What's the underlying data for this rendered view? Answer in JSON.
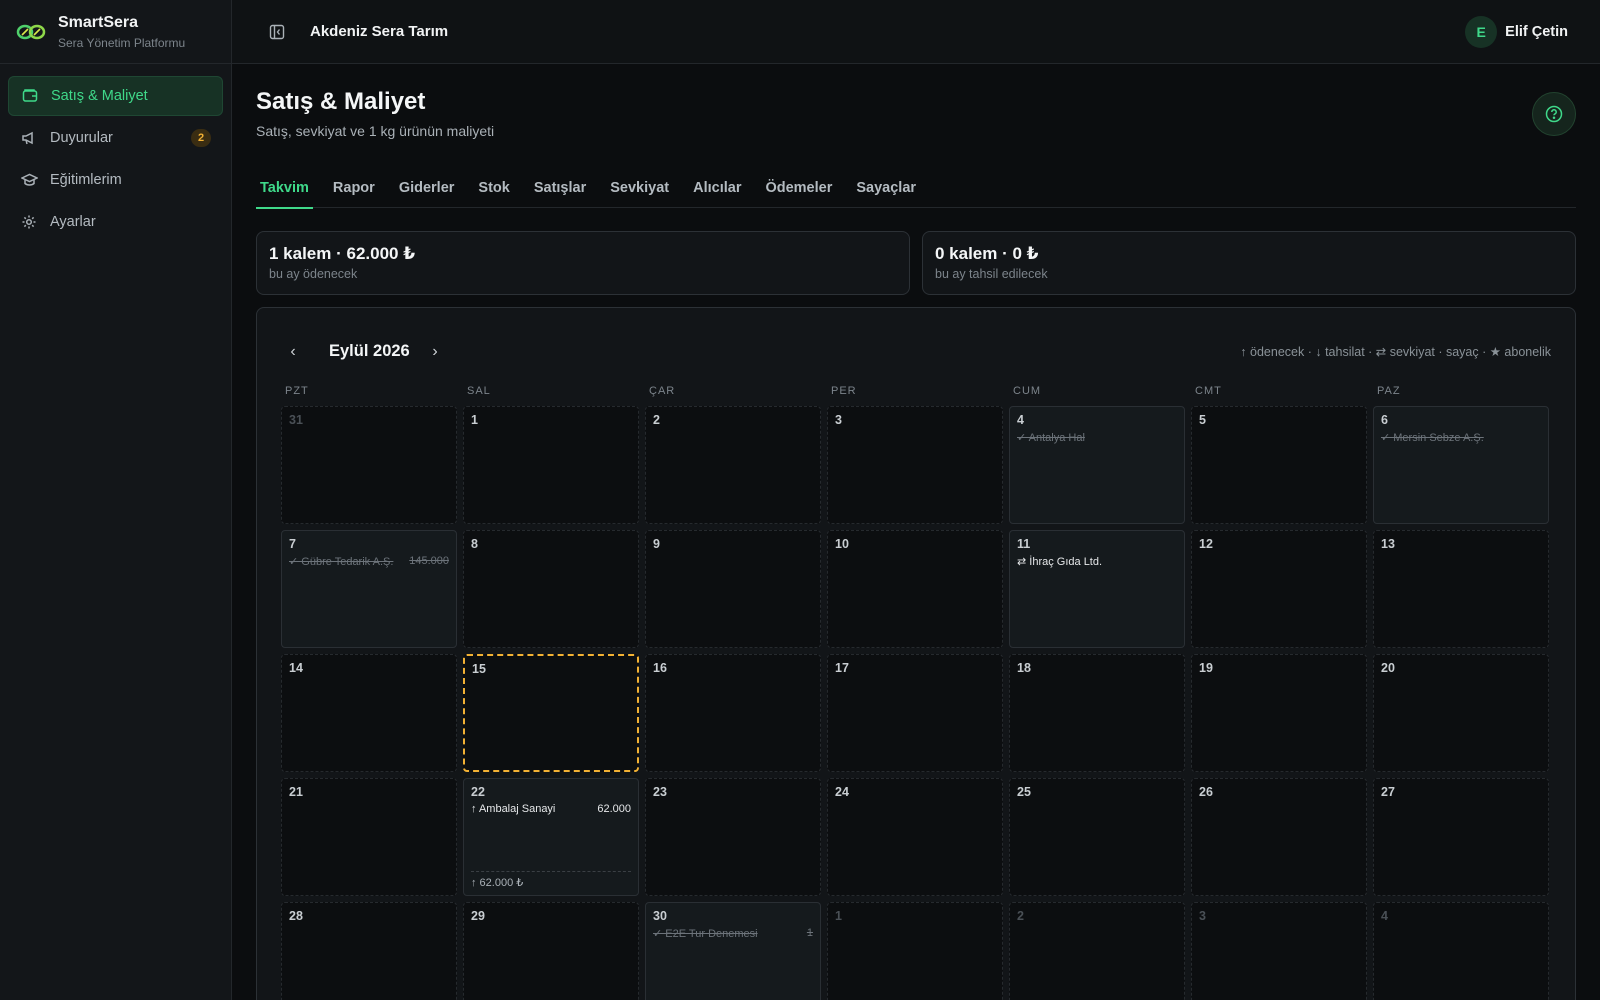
{
  "app": {
    "name": "SmartSera",
    "subtitle": "Sera Yönetim Platformu"
  },
  "sidebar": {
    "items": [
      {
        "label": "Satış & Maliyet",
        "icon": "wallet-icon",
        "active": true
      },
      {
        "label": "Duyurular",
        "icon": "megaphone-icon",
        "badge": "2"
      },
      {
        "label": "Eğitimlerim",
        "icon": "graduation-cap-icon"
      },
      {
        "label": "Ayarlar",
        "icon": "gear-icon"
      }
    ]
  },
  "topbar": {
    "organization": "Akdeniz Sera Tarım",
    "user": {
      "initial": "E",
      "name": "Elif Çetin"
    }
  },
  "page": {
    "title": "Satış & Maliyet",
    "subtitle": "Satış, sevkiyat ve 1 kg ürünün maliyeti"
  },
  "tabs": [
    {
      "label": "Takvim",
      "active": true
    },
    {
      "label": "Rapor"
    },
    {
      "label": "Giderler"
    },
    {
      "label": "Stok"
    },
    {
      "label": "Satışlar"
    },
    {
      "label": "Sevkiyat"
    },
    {
      "label": "Alıcılar"
    },
    {
      "label": "Ödemeler"
    },
    {
      "label": "Sayaçlar"
    }
  ],
  "summary": [
    {
      "value": "1 kalem · 62.000 ₺",
      "label": "bu ay ödenecek"
    },
    {
      "value": "0 kalem · 0 ₺",
      "label": "bu ay tahsil edilecek"
    }
  ],
  "calendar": {
    "prev": "‹",
    "next": "›",
    "month": "Eylül 2026",
    "legend": "↑ ödenecek · ↓ tahsilat · ⇄ sevkiyat · sayaç · ★ abonelik",
    "weekdays": [
      "PZT",
      "SAL",
      "ÇAR",
      "PER",
      "CUM",
      "CMT",
      "PAZ"
    ],
    "days": [
      {
        "n": "31",
        "out": true
      },
      {
        "n": "1"
      },
      {
        "n": "2"
      },
      {
        "n": "3"
      },
      {
        "n": "4",
        "events": [
          {
            "icon": "✓",
            "name": "Antalya Hal",
            "amount": "",
            "done": true
          }
        ]
      },
      {
        "n": "5"
      },
      {
        "n": "6",
        "events": [
          {
            "icon": "✓",
            "name": "Mersin Sebze A.Ş.",
            "amount": "",
            "done": true
          }
        ]
      },
      {
        "n": "7",
        "events": [
          {
            "icon": "✓",
            "name": "Gübre Tedarik A.Ş.",
            "amount": "145.000",
            "done": true
          }
        ]
      },
      {
        "n": "8"
      },
      {
        "n": "9"
      },
      {
        "n": "10"
      },
      {
        "n": "11",
        "events": [
          {
            "icon": "⇄",
            "name": "İhraç Gıda Ltd.",
            "amount": "",
            "done": false
          }
        ]
      },
      {
        "n": "12"
      },
      {
        "n": "13"
      },
      {
        "n": "14"
      },
      {
        "n": "15",
        "today": true
      },
      {
        "n": "16"
      },
      {
        "n": "17"
      },
      {
        "n": "18"
      },
      {
        "n": "19"
      },
      {
        "n": "20"
      },
      {
        "n": "21"
      },
      {
        "n": "22",
        "events": [
          {
            "icon": "↑",
            "name": "Ambalaj Sanayi",
            "amount": "62.000",
            "done": false
          }
        ],
        "total": "↑ 62.000 ₺"
      },
      {
        "n": "23"
      },
      {
        "n": "24"
      },
      {
        "n": "25"
      },
      {
        "n": "26"
      },
      {
        "n": "27"
      },
      {
        "n": "28"
      },
      {
        "n": "29"
      },
      {
        "n": "30",
        "events": [
          {
            "icon": "✓",
            "name": "E2E Tur Denemesi",
            "amount": "1",
            "done": true
          }
        ]
      },
      {
        "n": "1",
        "out": true
      },
      {
        "n": "2",
        "out": true
      },
      {
        "n": "3",
        "out": true
      },
      {
        "n": "4",
        "out": true
      }
    ]
  },
  "colors": {
    "accent": "#3fd98a",
    "warning": "#f2b134",
    "background": "#0b0d0f"
  }
}
